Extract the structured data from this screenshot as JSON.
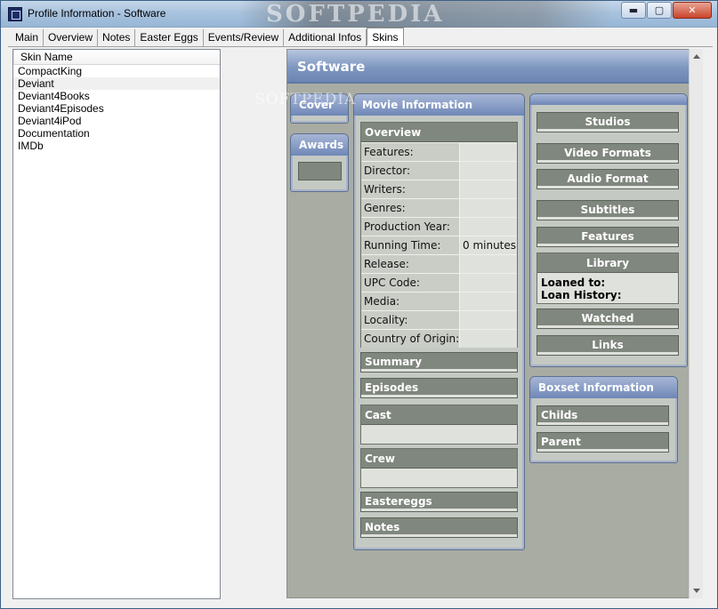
{
  "window": {
    "title": "Profile Information - Software",
    "watermark": "SOFTPEDIA",
    "controls": {
      "minimize": "▬",
      "maximize": "▢",
      "close": "✕"
    }
  },
  "tabs": [
    {
      "label": "Main"
    },
    {
      "label": "Overview"
    },
    {
      "label": "Notes"
    },
    {
      "label": "Easter Eggs"
    },
    {
      "label": "Events/Review"
    },
    {
      "label": "Additional Infos"
    },
    {
      "label": "Skins",
      "active": true
    }
  ],
  "skins": {
    "header": "Skin Name",
    "items": [
      "CompactKing",
      "Deviant",
      "Deviant4Books",
      "Deviant4Episodes",
      "Deviant4iPod",
      "Documentation",
      "IMDb"
    ],
    "selected": "Deviant"
  },
  "preview": {
    "title": "Software",
    "watermark": "SOFTPEDIA",
    "cover_tab": "Cover",
    "awards_tab": "Awards",
    "movie_info": {
      "title": "Movie Information",
      "overview_title": "Overview",
      "fields": [
        {
          "label": "Features:",
          "value": ""
        },
        {
          "label": "Director:",
          "value": ""
        },
        {
          "label": "Writers:",
          "value": ""
        },
        {
          "label": "Genres:",
          "value": ""
        },
        {
          "label": "Production Year:",
          "value": ""
        },
        {
          "label": "Running Time:",
          "value": "0 minutes"
        },
        {
          "label": "Release:",
          "value": ""
        },
        {
          "label": "UPC Code:",
          "value": ""
        },
        {
          "label": "Media:",
          "value": ""
        },
        {
          "label": "Locality:",
          "value": ""
        },
        {
          "label": "Country of Origin:",
          "value": ""
        }
      ],
      "summary": "Summary",
      "episodes": "Episodes",
      "cast": "Cast",
      "crew": "Crew",
      "eastereggs": "Eastereggs",
      "notes": "Notes"
    },
    "right": {
      "studios": "Studios",
      "video_formats": "Video Formats",
      "audio_format": "Audio Format",
      "subtitles": "Subtitles",
      "features": "Features",
      "library": "Library",
      "loaned_to": "Loaned to:",
      "loan_history": "Loan History:",
      "watched": "Watched",
      "links": "Links"
    },
    "boxset": {
      "title": "Boxset Information",
      "childs": "Childs",
      "parent": "Parent"
    }
  },
  "colors": {
    "preview_bg": "#a8aca3",
    "header_blue": "#7e97c0",
    "section_head": "#80877e"
  }
}
